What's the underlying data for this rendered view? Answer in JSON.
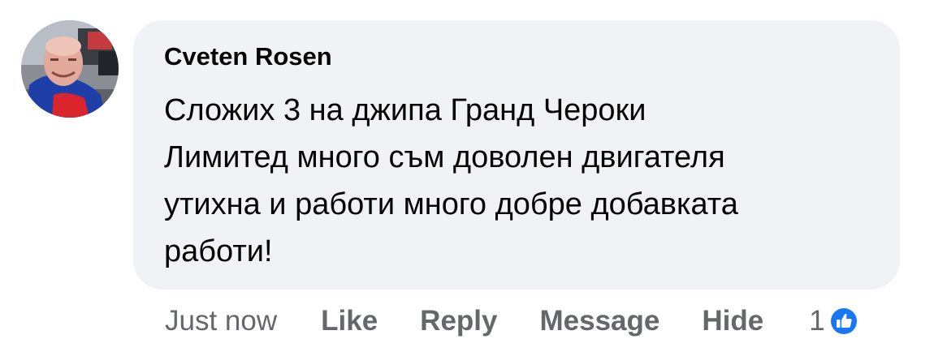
{
  "comment": {
    "author": "Cveten Rosen",
    "lines": [
      "Сложих 3 на джипа Гранд Чероки",
      "Лимитед много съм доволен двигателя",
      "утихна и работи много добре добавката",
      "работи!"
    ],
    "timestamp": "Just now",
    "actions": {
      "like": "Like",
      "reply": "Reply",
      "message": "Message",
      "hide": "Hide"
    },
    "reactions": {
      "count": "1",
      "icon": "like-thumb-icon",
      "color": "#1877f2"
    }
  }
}
